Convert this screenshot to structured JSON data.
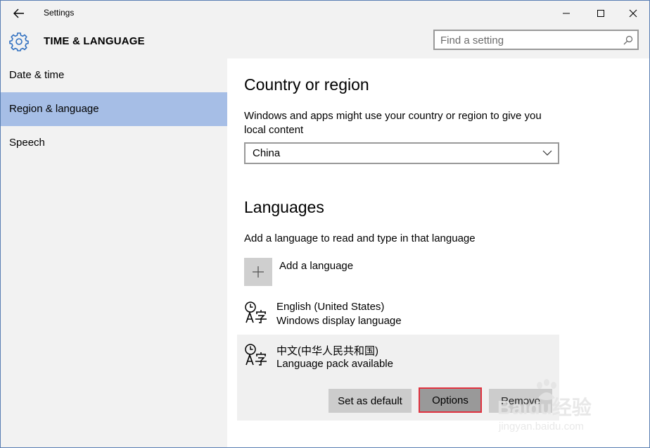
{
  "window": {
    "title": "Settings"
  },
  "header": {
    "section_title": "TIME & LANGUAGE"
  },
  "search": {
    "placeholder": "Find a setting"
  },
  "sidebar": {
    "items": [
      {
        "label": "Date & time",
        "selected": false
      },
      {
        "label": "Region & language",
        "selected": true
      },
      {
        "label": "Speech",
        "selected": false
      }
    ]
  },
  "region": {
    "heading": "Country or region",
    "description": "Windows and apps might use your country or region to give you local content",
    "selected_country": "China"
  },
  "languages": {
    "heading": "Languages",
    "description": "Add a language to read and type in that language",
    "add_label": "Add a language",
    "items": [
      {
        "name": "English (United States)",
        "status": "Windows display language"
      },
      {
        "name": "中文(中华人民共和国)",
        "status": "Language pack available"
      }
    ],
    "actions": {
      "set_default": "Set as default",
      "options": "Options",
      "remove": "Remove"
    }
  },
  "watermark": {
    "text": "Baidu经验",
    "url_text": "jingyan.baidu.com"
  },
  "colors": {
    "accent_selected": "#a6bee6",
    "highlight_border": "#e0313f"
  },
  "icons": [
    "back-arrow-icon",
    "minimize-icon",
    "maximize-icon",
    "close-icon",
    "gear-icon",
    "search-icon",
    "chevron-down-icon",
    "plus-icon",
    "language-icon"
  ]
}
